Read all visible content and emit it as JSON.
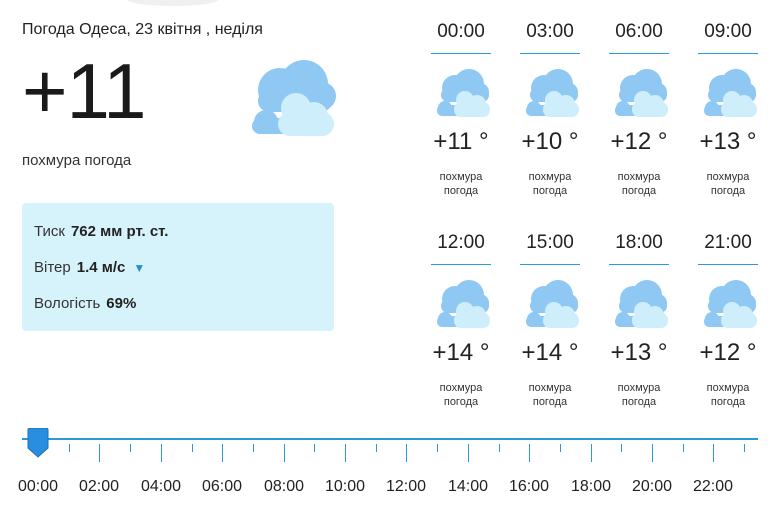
{
  "header": {
    "title": "Погода Одеса, 23 квітня , неділя"
  },
  "current": {
    "temp": "+11",
    "description": "похмура погода",
    "icon": "cloudy-icon"
  },
  "details": {
    "pressure_label": "Тиск",
    "pressure_value": "762 мм рт. ст.",
    "wind_label": "Вітер",
    "wind_value": "1.4 м/с",
    "humidity_label": "Вологість",
    "humidity_value": "69%"
  },
  "hourly": [
    {
      "time": "00:00",
      "temp": "+11 °",
      "cond_line1": "похмура",
      "cond_line2": "погода"
    },
    {
      "time": "03:00",
      "temp": "+10 °",
      "cond_line1": "похмура",
      "cond_line2": "погода"
    },
    {
      "time": "06:00",
      "temp": "+12 °",
      "cond_line1": "похмура",
      "cond_line2": "погода"
    },
    {
      "time": "09:00",
      "temp": "+13 °",
      "cond_line1": "похмура",
      "cond_line2": "погода"
    },
    {
      "time": "12:00",
      "temp": "+14 °",
      "cond_line1": "похмура",
      "cond_line2": "погода"
    },
    {
      "time": "15:00",
      "temp": "+14 °",
      "cond_line1": "похмура",
      "cond_line2": "погода"
    },
    {
      "time": "18:00",
      "temp": "+13 °",
      "cond_line1": "похмура",
      "cond_line2": "погода"
    },
    {
      "time": "21:00",
      "temp": "+12 °",
      "cond_line1": "похмура",
      "cond_line2": "погода"
    }
  ],
  "timeline": {
    "labels": [
      "00:00",
      "02:00",
      "04:00",
      "06:00",
      "08:00",
      "10:00",
      "12:00",
      "14:00",
      "16:00",
      "18:00",
      "20:00",
      "22:00"
    ],
    "selected": "00:00"
  },
  "colors": {
    "accent": "#2a9ad8",
    "panel": "#d6f3fb",
    "cloud_dark": "#8fc8f2",
    "cloud_light": "#cdeefa"
  }
}
